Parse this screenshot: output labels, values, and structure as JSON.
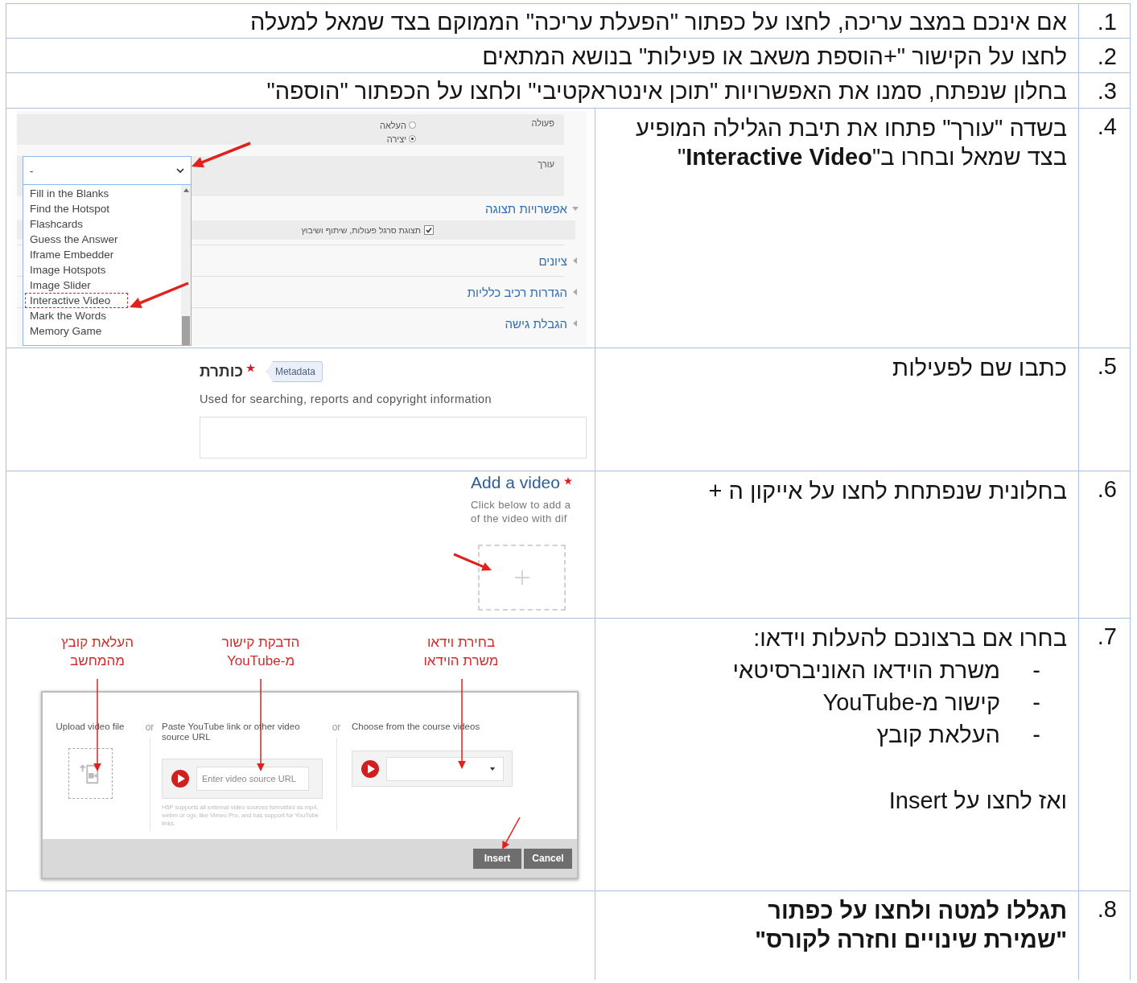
{
  "steps": [
    {
      "number": "1.",
      "kind": "wide",
      "bold": false,
      "text": "אם אינכם במצב עריכה, לחצו על כפתור \"הפעלת עריכה\" הממוקם בצד שמאל למעלה"
    },
    {
      "number": "2.",
      "kind": "wide",
      "bold": false,
      "text": "לחצו על הקישור \"+הוספת משאב או פעילות\" בנושא המתאים"
    },
    {
      "number": "3.",
      "kind": "wide",
      "bold": false,
      "text": "בחלון שנפתח, סמנו את האפשרויות \"תוכן אינטראקטיבי\" ולחצו על הכפתור \"הוספה\""
    },
    {
      "number": "4.",
      "kind": "shot",
      "bold": false,
      "text": "בשדה \"עורך\" פתחו את תיבת הגלילה המופיע בצד שמאל  ובחרו ב\"**Interactive Video**\"",
      "screenshot": {
        "kind": "activity-settings",
        "action_label": "פעולה",
        "radios": [
          {
            "label": "העלאה",
            "selected": false
          },
          {
            "label": "יצירה",
            "selected": true
          }
        ],
        "editor_label": "עורך",
        "select_value": "-",
        "options": [
          {
            "label": "Fill in the Blanks",
            "selected": false
          },
          {
            "label": "Find the Hotspot",
            "selected": false
          },
          {
            "label": "Flashcards",
            "selected": false
          },
          {
            "label": "Guess the Answer",
            "selected": false
          },
          {
            "label": "Iframe Embedder",
            "selected": false
          },
          {
            "label": "Image Hotspots",
            "selected": false
          },
          {
            "label": "Image Slider",
            "selected": false
          },
          {
            "label": "Interactive Video",
            "selected": true
          },
          {
            "label": "Mark the Words",
            "selected": false
          },
          {
            "label": "Memory Game",
            "selected": false
          }
        ],
        "sections": [
          {
            "label": "אפשרויות תצוגה",
            "expanded": true,
            "checkbox": {
              "label": "תצוגת סרגל פעולות, שיתוף ושיבוץ",
              "checked": true
            }
          },
          {
            "label": "ציונים",
            "expanded": false
          },
          {
            "label": "הגדרות רכיב כלליות",
            "expanded": false
          },
          {
            "label": "הגבלת גישה",
            "expanded": false
          }
        ]
      }
    },
    {
      "number": "5.",
      "kind": "shot",
      "bold": false,
      "text": "כתבו שם לפעילות",
      "screenshot": {
        "kind": "title-field",
        "label": "כותרת",
        "required": true,
        "badge": "Metadata",
        "description": "Used for searching, reports and copyright information"
      }
    },
    {
      "number": "6.",
      "kind": "shot",
      "bold": false,
      "text": "בחלונית שנפתחת לחצו על אייקון ה +",
      "screenshot": {
        "kind": "add-video",
        "heading": "Add a video",
        "required": true,
        "description_lines": [
          "Click below to add a",
          "of the video with dif"
        ]
      }
    },
    {
      "number": "7.",
      "kind": "shot",
      "bold": false,
      "text": "בחרו אם ברצונכם להעלות וידאו:",
      "bullets": [
        {
          "marker": "-",
          "text": "משרת הוידאו האוניברסיטאי"
        },
        {
          "marker": "-",
          "text": "קישור מ-YouTube"
        },
        {
          "marker": "-",
          "text": "העלאת קובץ"
        }
      ],
      "after": "ואז לחצו על Insert",
      "screenshot": {
        "kind": "video-dialog",
        "callouts": [
          {
            "lines": [
              "בחירת וידאו",
              "משרת הוידאו"
            ]
          },
          {
            "lines": [
              "הדבקת קישור",
              "מ-YouTube"
            ]
          },
          {
            "lines": [
              "העלאת קובץ",
              "מהמחשב"
            ]
          }
        ],
        "upload_label": "Upload video file",
        "separators": [
          "or",
          "or"
        ],
        "url_label": "Paste YouTube link or other video source URL",
        "url_placeholder": "Enter video source URL",
        "url_help": "H5P supports all external video sources formatted as mp4, webm or ogv, like Vimeo Pro, and has support for YouTube links.",
        "course_label": "Choose from the course videos",
        "buttons": [
          "Cancel",
          "Insert"
        ]
      }
    },
    {
      "number": "8.",
      "kind": "narrow",
      "bold": true,
      "text": "תגללו למטה ולחצו על כפתור\n\"שמירת שינויים וחזרה לקורס\""
    }
  ]
}
